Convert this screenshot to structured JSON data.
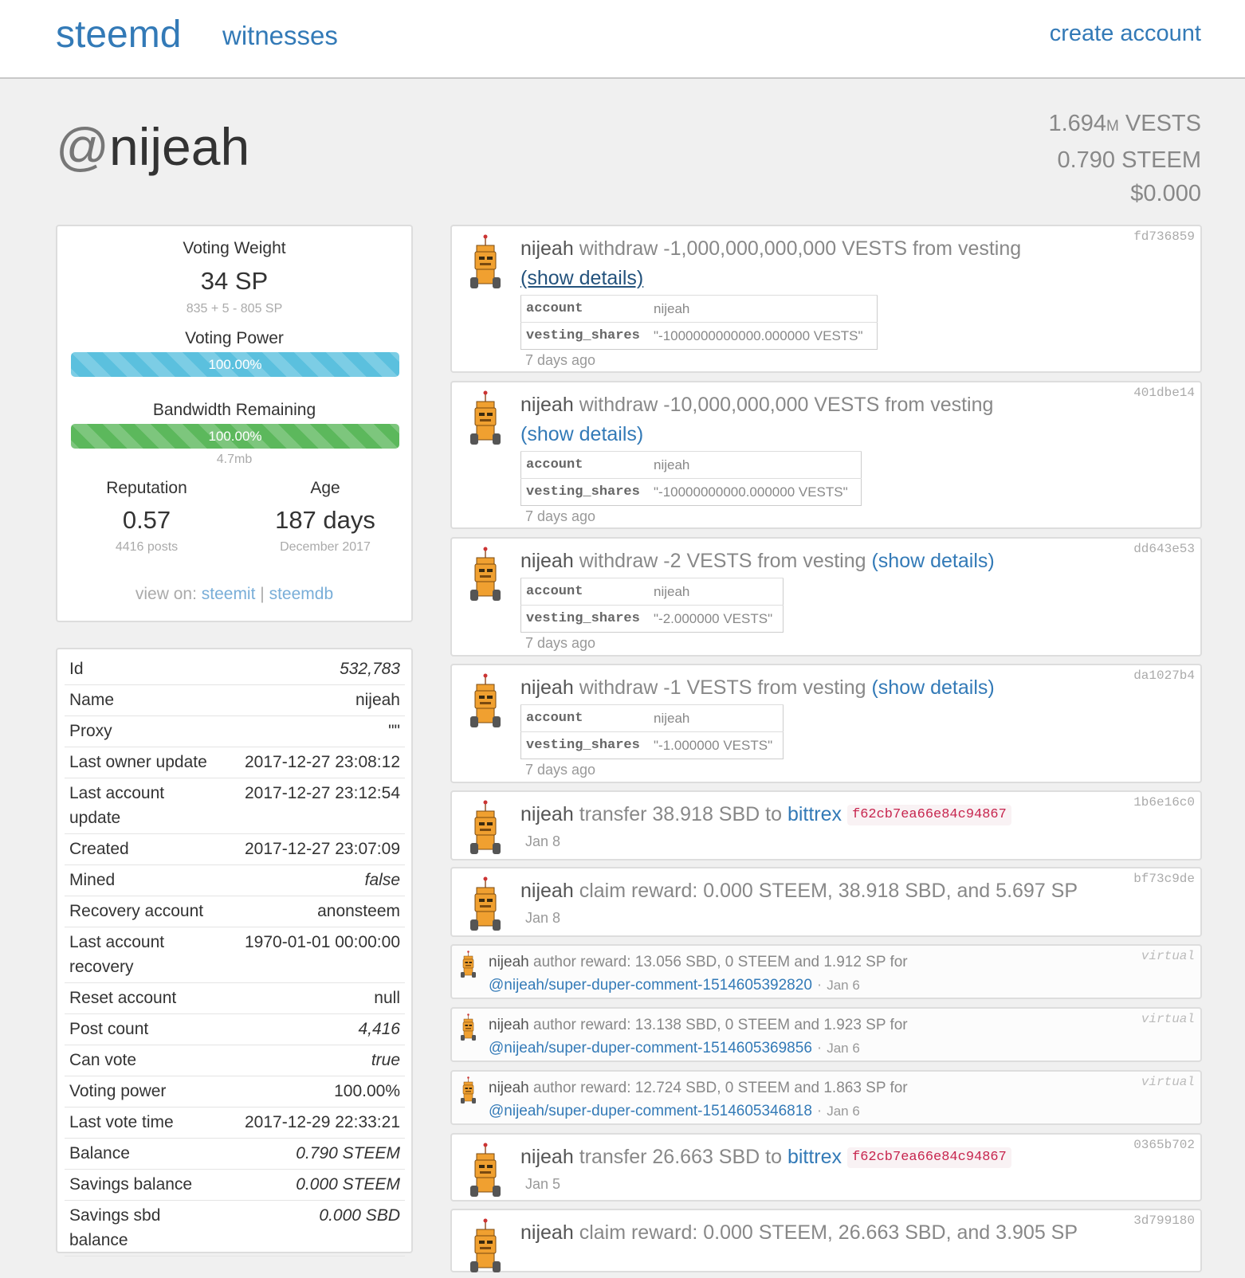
{
  "nav": {
    "brand": "steemd",
    "witnesses": "witnesses",
    "create_account": "create account"
  },
  "header": {
    "at": "@",
    "account": "nijeah",
    "vests_num": "1.694",
    "vests_mag": "M",
    "vests_unit": "VESTS",
    "steem": "0.790 STEEM",
    "usd": "$0.000"
  },
  "stats": {
    "voting_weight_label": "Voting Weight",
    "voting_weight": "34 SP",
    "voting_weight_detail": "835 + 5 - 805 SP",
    "voting_power_label": "Voting Power",
    "voting_power": "100.00%",
    "voting_power_value": 1.0,
    "bandwidth_label": "Bandwidth Remaining",
    "bandwidth": "100.00%",
    "bandwidth_value": 1.0,
    "bandwidth_detail": "4.7mb",
    "reputation_label": "Reputation",
    "reputation": "0.57",
    "posts": "4416 posts",
    "age_label": "Age",
    "age": "187 days",
    "since": "December 2017",
    "view_on_label": "view on:",
    "view_on_steemit": "steemit",
    "view_on_sep": "|",
    "view_on_steemdb": "steemdb"
  },
  "props": [
    {
      "key": "Id",
      "value": "532,783",
      "italic": true
    },
    {
      "key": "Name",
      "value": "nijeah",
      "italic": false
    },
    {
      "key": "Proxy",
      "value": "\"\"",
      "italic": false
    },
    {
      "key": "Last owner update",
      "value": "2017-12-27 23:08:12",
      "italic": false
    },
    {
      "key": "Last account update",
      "value": "2017-12-27 23:12:54",
      "italic": false,
      "wrap": true
    },
    {
      "key": "Created",
      "value": "2017-12-27 23:07:09",
      "italic": false
    },
    {
      "key": "Mined",
      "value": "false",
      "italic": true
    },
    {
      "key": "Recovery account",
      "value": "anonsteem",
      "italic": false
    },
    {
      "key": "Last account recovery",
      "value": "1970-01-01 00:00:00",
      "italic": false,
      "wrap": true
    },
    {
      "key": "Reset account",
      "value": "null",
      "italic": false
    },
    {
      "key": "Post count",
      "value": "4,416",
      "italic": true
    },
    {
      "key": "Can vote",
      "value": "true",
      "italic": true
    },
    {
      "key": "Voting power",
      "value": "100.00%",
      "italic": false
    },
    {
      "key": "Last vote time",
      "value": "2017-12-29 22:33:21",
      "italic": false
    },
    {
      "key": "Balance",
      "value": "0.790 STEEM",
      "italic": true
    },
    {
      "key": "Savings balance",
      "value": "0.000 STEEM",
      "italic": true
    },
    {
      "key": "Savings sbd balance",
      "value": "0.000 SBD",
      "italic": true,
      "wrap": true
    }
  ],
  "ops": {
    "withdraw1": {
      "hash": "fd736859",
      "who": "nijeah",
      "text": "withdraw -1,000,000,000,000 VESTS from vesting",
      "details": "(show details)",
      "k1": "account",
      "v1": "nijeah",
      "k2": "vesting_shares",
      "v2": "\"-1000000000000.000000 VESTS\"",
      "time": "7 days ago"
    },
    "withdraw2": {
      "hash": "401dbe14",
      "who": "nijeah",
      "text": "withdraw -10,000,000,000 VESTS from vesting",
      "details": "(show details)",
      "k1": "account",
      "v1": "nijeah",
      "k2": "vesting_shares",
      "v2": "\"-10000000000.000000 VESTS\"",
      "time": "7 days ago"
    },
    "withdraw3": {
      "hash": "dd643e53",
      "who": "nijeah",
      "text": "withdraw -2 VESTS from vesting",
      "details": "(show details)",
      "k1": "account",
      "v1": "nijeah",
      "k2": "vesting_shares",
      "v2": "\"-2.000000 VESTS\"",
      "time": "7 days ago"
    },
    "withdraw4": {
      "hash": "da1027b4",
      "who": "nijeah",
      "text": "withdraw -1 VESTS from vesting",
      "details": "(show details)",
      "k1": "account",
      "v1": "nijeah",
      "k2": "vesting_shares",
      "v2": "\"-1.000000 VESTS\"",
      "time": "7 days ago"
    },
    "transfer1": {
      "hash": "1b6e16c0",
      "who": "nijeah",
      "text": "transfer 38.918 SBD to",
      "to": "bittrex",
      "memo": "f62cb7ea66e84c94867",
      "time": "Jan 8"
    },
    "claim1": {
      "hash": "bf73c9de",
      "who": "nijeah",
      "text": "claim reward: 0.000 STEEM, 38.918 SBD, and 5.697 SP",
      "time": "Jan 8"
    },
    "author1": {
      "tag": "virtual",
      "who": "nijeah",
      "text": "author reward: 13.056 SBD, 0 STEEM and 1.912 SP for",
      "link": "@nijeah/super-duper-comment-1514605392820",
      "dot": "·",
      "date": "Jan 6"
    },
    "author2": {
      "tag": "virtual",
      "who": "nijeah",
      "text": "author reward: 13.138 SBD, 0 STEEM and 1.923 SP for",
      "link": "@nijeah/super-duper-comment-1514605369856",
      "dot": "·",
      "date": "Jan 6"
    },
    "author3": {
      "tag": "virtual",
      "who": "nijeah",
      "text": "author reward: 12.724 SBD, 0 STEEM and 1.863 SP for",
      "link": "@nijeah/super-duper-comment-1514605346818",
      "dot": "·",
      "date": "Jan 6"
    },
    "transfer2": {
      "hash": "0365b702",
      "who": "nijeah",
      "text": "transfer 26.663 SBD to",
      "to": "bittrex",
      "memo": "f62cb7ea66e84c94867",
      "time": "Jan 5"
    },
    "claim2": {
      "hash": "3d799180",
      "who": "nijeah",
      "text": "claim reward: 0.000 STEEM, 26.663 SBD, and 3.905 SP"
    }
  },
  "colors": {
    "link": "#337ab7",
    "progress_blue": "#5bc0de",
    "progress_green": "#5cb85c",
    "memo": "#c7254e",
    "robot": "#f0a030"
  }
}
